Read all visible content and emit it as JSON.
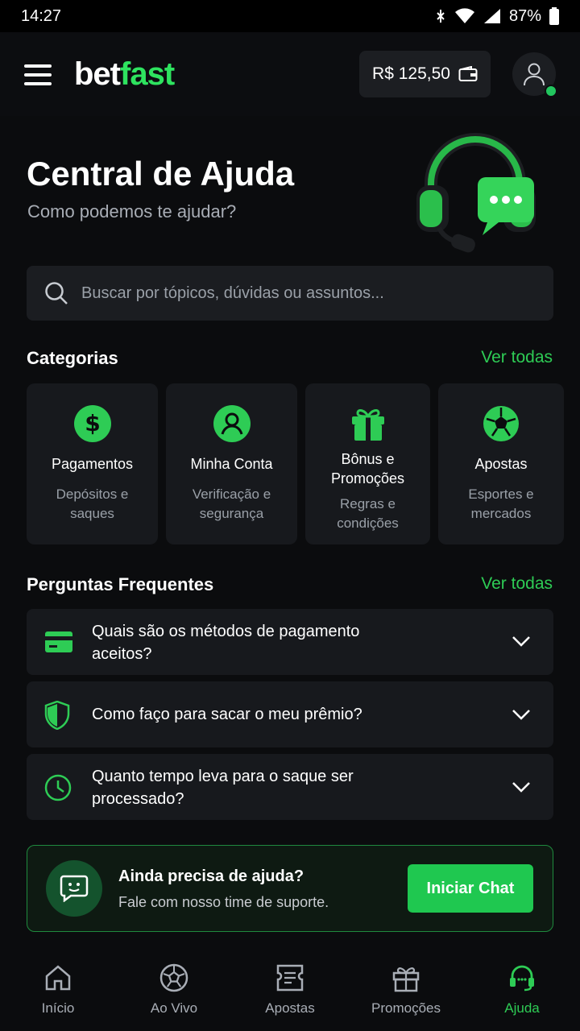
{
  "status_bar": {
    "time": "14:27",
    "battery": "87%"
  },
  "header": {
    "logo_part1": "bet",
    "logo_part2": "fast",
    "balance": "R$ 125,50"
  },
  "hero": {
    "title": "Central de Ajuda",
    "subtitle": "Como podemos te ajudar?"
  },
  "search": {
    "placeholder": "Buscar por tópicos, dúvidas ou assuntos..."
  },
  "categories": {
    "title": "Categorias",
    "see_all": "Ver todas",
    "items": [
      {
        "icon": "dollar-icon",
        "title": "Pagamentos",
        "desc1": "Depósitos e",
        "desc2": "saques"
      },
      {
        "icon": "user-icon",
        "title": "Minha Conta",
        "desc1": "Verificação e",
        "desc2": "segurança"
      },
      {
        "icon": "gift-icon",
        "title1": "Bônus e",
        "title2": "Promoções",
        "desc1": "Regras e",
        "desc2": "condições"
      },
      {
        "icon": "soccer-ball-icon",
        "title": "Apostas",
        "desc1": "Esportes e",
        "desc2": "mercados"
      }
    ]
  },
  "faq": {
    "title": "Perguntas Frequentes",
    "see_all": "Ver todas",
    "items": [
      {
        "icon": "credit-card-icon",
        "line1": "Quais são os métodos de pagamento",
        "line2": "aceitos?"
      },
      {
        "icon": "shield-icon",
        "line1": "Como faço para sacar o meu prêmio?"
      },
      {
        "icon": "clock-icon",
        "line1": "Quanto tempo leva para o saque ser",
        "line2": "processado?"
      }
    ]
  },
  "support": {
    "title": "Ainda precisa de ajuda?",
    "subtitle": "Fale com nosso time de suporte.",
    "button": "Iniciar Chat"
  },
  "bottom_nav": {
    "items": [
      {
        "label": "Início",
        "icon": "home-icon"
      },
      {
        "label": "Ao Vivo",
        "icon": "soccer-ball-icon"
      },
      {
        "label": "Apostas",
        "icon": "ticket-icon"
      },
      {
        "label": "Promoções",
        "icon": "gift-icon"
      },
      {
        "label": "Ajuda",
        "icon": "headset-icon",
        "active": true
      }
    ]
  },
  "colors": {
    "accent": "#2ecc55",
    "background": "#0b0c0e",
    "card": "#17191d"
  }
}
